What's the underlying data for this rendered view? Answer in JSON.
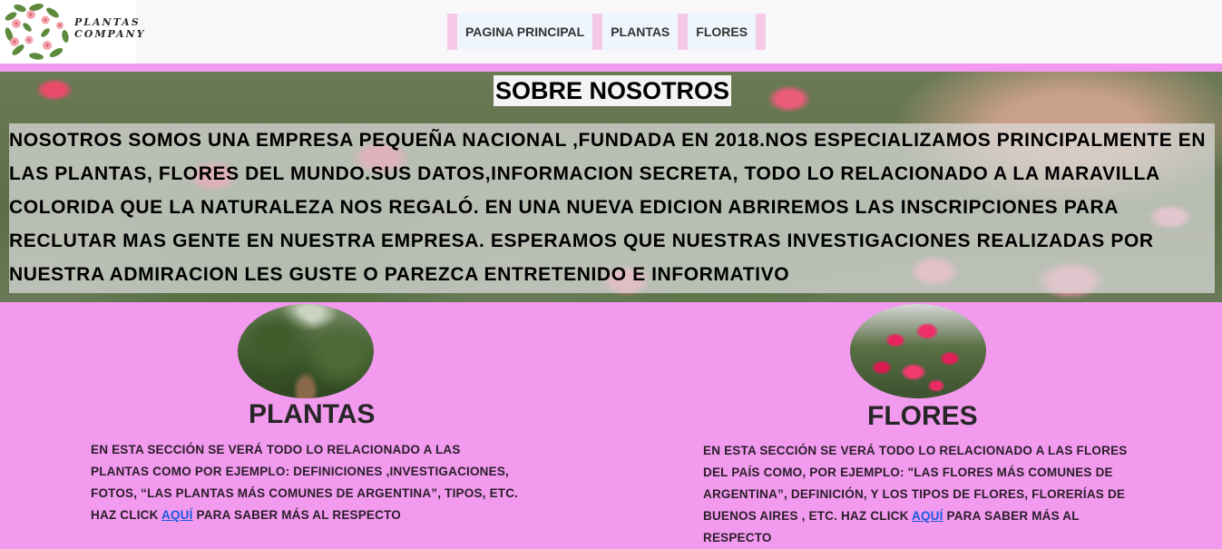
{
  "logo": {
    "line1": "PLANTAS",
    "line2": "COMPANY"
  },
  "nav": {
    "items": [
      {
        "label": "PAGINA PRINCIPAL"
      },
      {
        "label": "PLANTAS"
      },
      {
        "label": "FLORES"
      }
    ]
  },
  "about": {
    "title": "SOBRE NOSOTROS",
    "text": "NOSOTROS SOMOS UNA EMPRESA PEQUEÑA NACIONAL ,FUNDADA EN 2018.NOS ESPECIALIZAMOS PRINCIPALMENTE EN LAS PLANTAS, FLORES DEL MUNDO.SUS DATOS,INFORMACION SECRETA, TODO LO RELACIONADO A LA MARAVILLA COLORIDA QUE LA NATURALEZA NOS REGALÓ. EN UNA NUEVA EDICION ABRIREMOS LAS INSCRIPCIONES PARA RECLUTAR MAS GENTE EN NUESTRA EMPRESA. ESPERAMOS QUE NUESTRAS INVESTIGACIONES REALIZADAS POR NUESTRA ADMIRACION LES GUSTE O PAREZCA ENTRETENIDO E INFORMATIVO"
  },
  "cards": {
    "plants": {
      "title": "PLANTAS",
      "text_before": "EN ESTA SECCIÓN SE VERÁ TODO LO RELACIONADO A LAS PLANTAS COMO POR EJEMPLO: DEFINICIONES ,INVESTIGACIONES, FOTOS, “LAS PLANTAS MÁS COMUNES DE ARGENTINA”, TIPOS, ETC. HAZ CLICK ",
      "link": "AQUÍ",
      "text_after": " PARA SABER MÁS AL RESPECTO"
    },
    "flowers": {
      "title": "FLORES",
      "text_before": "EN ESTA SECCIÓN SE VERÁ TODO LO RELACIONADO A LAS FLORES DEL PAÍS COMO, POR EJEMPLO: \"LAS FLORES MÁS COMUNES DE ARGENTINA”, DEFINICIÓN, Y LOS TIPOS DE FLORES, FLORERÍAS DE BUENOS AIRES , ETC. HAZ CLICK ",
      "link": "AQUÍ",
      "text_after": " PARA SABER MÁS AL RESPECTO"
    }
  },
  "colors": {
    "page_bg": "#f29aee",
    "nav_separator": "#f6c9e6",
    "link": "#1a5ae0"
  },
  "icons": {
    "logo": "floral-wreath-logo-icon",
    "plants_image": "garden-path-photo",
    "flowers_image": "bougainvillea-photo"
  }
}
